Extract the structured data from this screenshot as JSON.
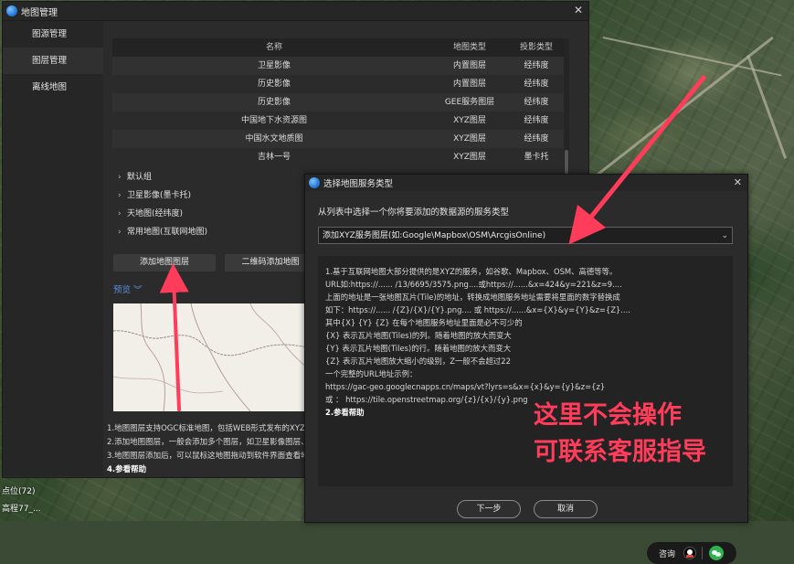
{
  "background": {
    "labels": [
      "点位(72)",
      "高程77_..."
    ]
  },
  "window": {
    "title": "地图管理",
    "close_glyph": "✕",
    "nav": [
      "图源管理",
      "图层管理",
      "离线地图"
    ],
    "table": {
      "headers": [
        "名称",
        "地图类型",
        "投影类型"
      ],
      "rows": [
        [
          "卫星影像",
          "内置图层",
          "经纬度"
        ],
        [
          "历史影像",
          "内置图层",
          "经纬度"
        ],
        [
          "历史影像",
          "GEE服务图层",
          "经纬度"
        ],
        [
          "中国地下水资源图",
          "XYZ图层",
          "经纬度"
        ],
        [
          "中国水文地质图",
          "XYZ图层",
          "经纬度"
        ],
        [
          "吉林一号",
          "XYZ图层",
          "墨卡托"
        ]
      ]
    },
    "groups": [
      "默认组",
      "卫星影像(墨卡托)",
      "天地图(经纬度)",
      "常用地图(互联网地图)"
    ],
    "add_layer_button": "添加地图图层",
    "qr_add_button": "二维码添加地图",
    "preview_label": "预览 ",
    "tips": [
      "1.地图图层支持OGC标准地图，包括WEB形式发布的XYZ、",
      "2.添加地图图层，一般会添加多个图层，如卫星影像图层、",
      "3.地图图层添加后，可以鼠标这地图拖动到软件界面查看地图",
      "4.参看帮助"
    ]
  },
  "dialog": {
    "title": "选择地图服务类型",
    "close_glyph": "✕",
    "instruction": "从列表中选择一个你将要添加的数据源的服务类型",
    "selected_option": "添加XYZ服务图层(如:Google\\Mapbox\\OSM\\ArcgisOnline)",
    "select_arrow": "⌄",
    "help_lines": [
      "1.基于互联网地图大部分提供的是XYZ的服务，如谷歌、Mapbox、OSM、高德等等。",
      "URL如:https://...... /13/6695/3575.png....或https://......&x=424&y=221&z=9....",
      "上面的地址是一张地图瓦片(Tile)的地址，转换成地图服务地址需要将里面的数字替换成",
      "如下：https://...... /{Z}/{X}/{Y}.png.... 或 https://......&x={X}&y={Y}&z={Z}....",
      "其中{X} {Y} {Z} 在每个地图服务地址里面是必不可少的",
      "{X} 表示瓦片地图(Tiles)的列。随着地图的放大而变大",
      "{Y} 表示瓦片地图(Tiles)的行。随着地图的放大而变大",
      "{Z} 表示瓦片地图放大缩小的级别，Z一般不会超过22",
      "一个完整的URL地址示例：",
      "https://gac-geo.googlecnapps.cn/maps/vt?lyrs=s&x={x}&y={y}&z={z}",
      "或 ： https://tile.openstreetmap.org/{z}/{x}/{y}.png",
      "2.参看帮助"
    ],
    "overlay_line1": "这里不会操作",
    "overlay_line2": "可联系客服指导",
    "consult_label": "咨询",
    "next_button": "下一步",
    "cancel_button": "取消"
  },
  "colors": {
    "annotation_red": "#ff3c5a",
    "link_blue": "#5a8fd8",
    "wechat_green": "#2fb14d"
  }
}
